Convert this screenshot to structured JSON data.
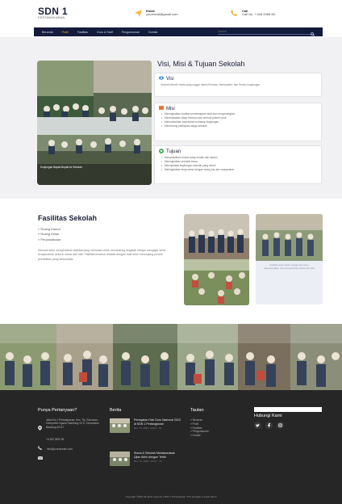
{
  "brand": {
    "name": "SDN 1",
    "subtitle": "PERTANGKARAN"
  },
  "contact": {
    "email_label": "Email",
    "email_value": "youremail@gmail.com",
    "call_label": "Call",
    "call_value": "Call Us: + 628 2055 56"
  },
  "nav": {
    "items": [
      "Beranda",
      "Profil",
      "Fasilitas",
      "Guru & Staff",
      "Pengumuman",
      "Kontak"
    ],
    "active_index": 1,
    "search_placeholder": "Search"
  },
  "vision": {
    "title": "Visi, Misi & Tujuan Sekolah",
    "visi": {
      "heading": "Visi",
      "text": "Sekolah Bersih Hasta yang unggul dalam Prestasi, Berkarakter, dan Peduli Lingkungan"
    },
    "misi": {
      "heading": "Misi",
      "items": [
        "Meningkatkan kualitas pembelajaran aktif dan menyenangkan",
        "Membiasakan sikap beriman dan berbudi pekerti luhur",
        "Menumbuhkan kepedulian terhadap lingkungan",
        "Mendorong partisipasi warga sekolah"
      ]
    },
    "tujuan": {
      "heading": "Tujuan",
      "items": [
        "Menghasilkan lulusan yang cerdas dan santun",
        "Meningkatkan prestasi siswa",
        "Menciptakan lingkungan sekolah yang bersih",
        "Meningkatkan kerja sama dengan orang tua dan masyarakat"
      ]
    },
    "image_caption": "Kunjungan Bapak Bupati ke Sekolah"
  },
  "facilities": {
    "title": "Fasilitas Sekolah",
    "items": [
      "Ruang Kantor",
      "Ruang Kelas",
      "Perpustakaan"
    ],
    "description": "Sekolah kami menyediakan fasilitas yang memadai untuk mendukung kegiatan belajar mengajar serta kenyamanan seluruh siswa dan staf. Fasilitas tersebut dirawat dengan baik demi menunjang proses pendidikan yang berkualitas.",
    "caption": "Fasilitas kami selalu terjaga dan terus dikembangkan demi kenyamanan siswa dan staf"
  },
  "footer": {
    "contact_heading": "Punya Pertanyaan?",
    "address": "Jalan No.1 Pertangkaran, Kec. Tlp. Rowosari, Kabupaten Ngada, Bandung 43 Jl. Kecamatan Bandung 40117",
    "phone": "+6 282 3599 56",
    "email": "info@yourdomain.com",
    "news_heading": "Berita",
    "news": [
      {
        "title": "Peringatan Hari Guru Nasional 2023 di SDN 1 Pertangkaran",
        "meta": "Nov. 24, 2023 · Admin · 19"
      },
      {
        "title": "Siswa & Sekolah Melaksanakan Ujian Akhir dengan Tertib",
        "meta": "Dec. 12, 2023 · Admin · 19"
      }
    ],
    "links_heading": "Tautan",
    "links": [
      "Beranda",
      "Profil",
      "Fasilitas",
      "Pengumuman",
      "Kontak"
    ],
    "newsletter_heading": "Hubungi Kami",
    "copyright": "Copyright ©2024 All rights reserved | SDN 1 Pertangkaran. This template is made with ♥"
  },
  "colors": {
    "navy": "#141b3c",
    "accent": "#f2b640",
    "section_bg": "#f1f1f3",
    "footer_bg": "#262626"
  }
}
